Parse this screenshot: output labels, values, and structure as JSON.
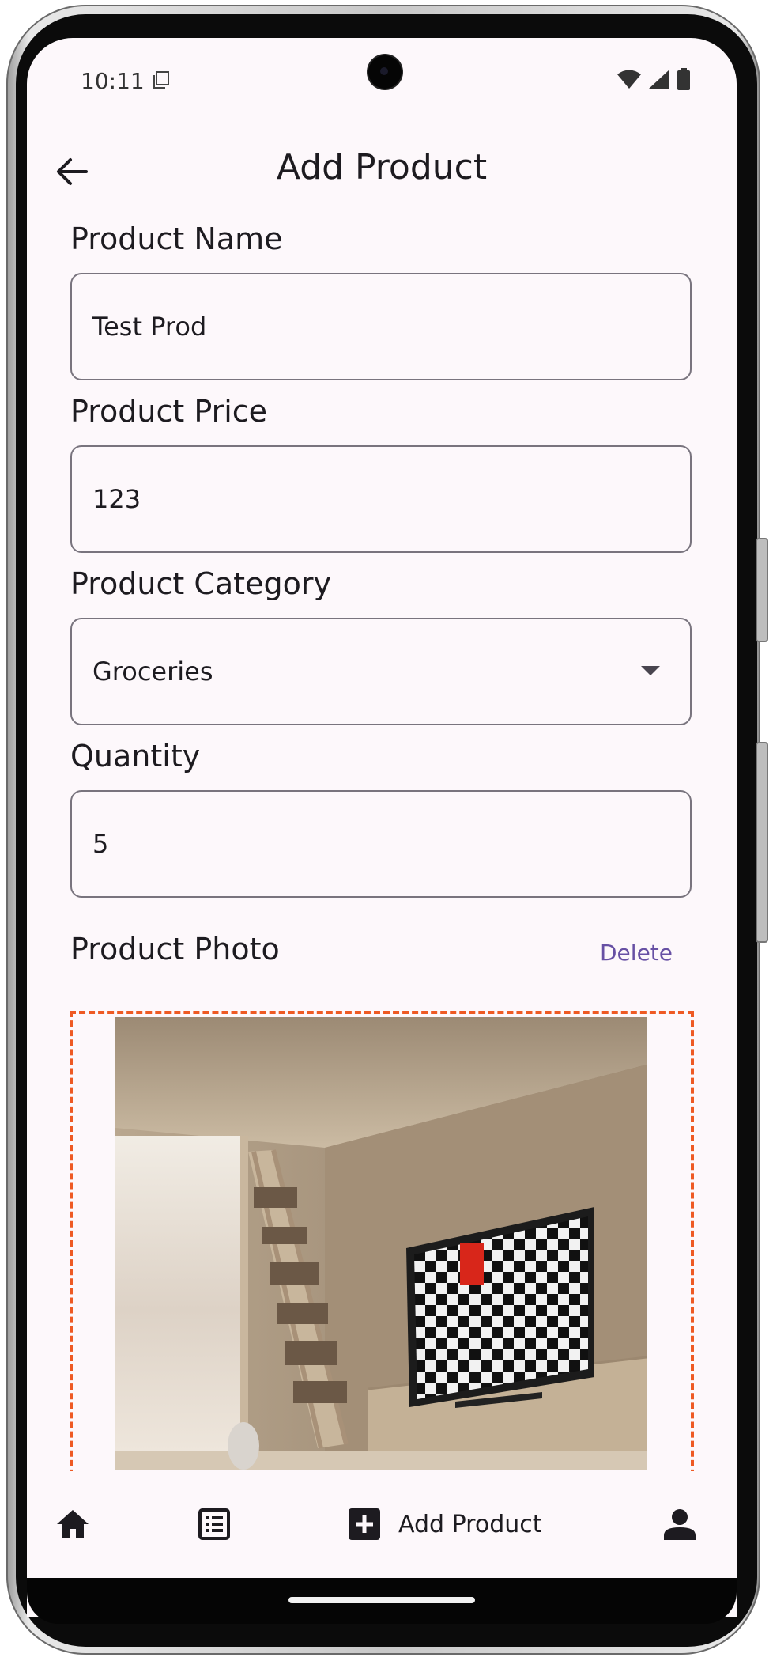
{
  "status_bar": {
    "time": "10:11",
    "icons": [
      "sim-card-icon",
      "wifi-icon",
      "cellular-signal-icon",
      "battery-icon"
    ]
  },
  "app_bar": {
    "title": "Add Product",
    "back_icon": "arrow-left-icon"
  },
  "form": {
    "product_name": {
      "label": "Product Name",
      "value": "Test Prod"
    },
    "product_price": {
      "label": "Product Price",
      "value": "123"
    },
    "product_category": {
      "label": "Product Category",
      "value": "Groceries",
      "icon": "dropdown-arrow-icon"
    },
    "quantity": {
      "label": "Quantity",
      "value": "5"
    },
    "product_photo": {
      "label": "Product Photo",
      "delete_label": "Delete"
    }
  },
  "bottom_nav": {
    "items": [
      {
        "icon": "home-icon"
      },
      {
        "icon": "list-icon"
      },
      {
        "icon": "add-box-icon",
        "label": "Add Product"
      },
      {
        "icon": "person-icon"
      }
    ]
  },
  "colors": {
    "background": "#fdf8fb",
    "text": "#1d1b20",
    "outline": "#79747e",
    "accent": "#6750a4",
    "dashed_border": "#ee5a24"
  }
}
